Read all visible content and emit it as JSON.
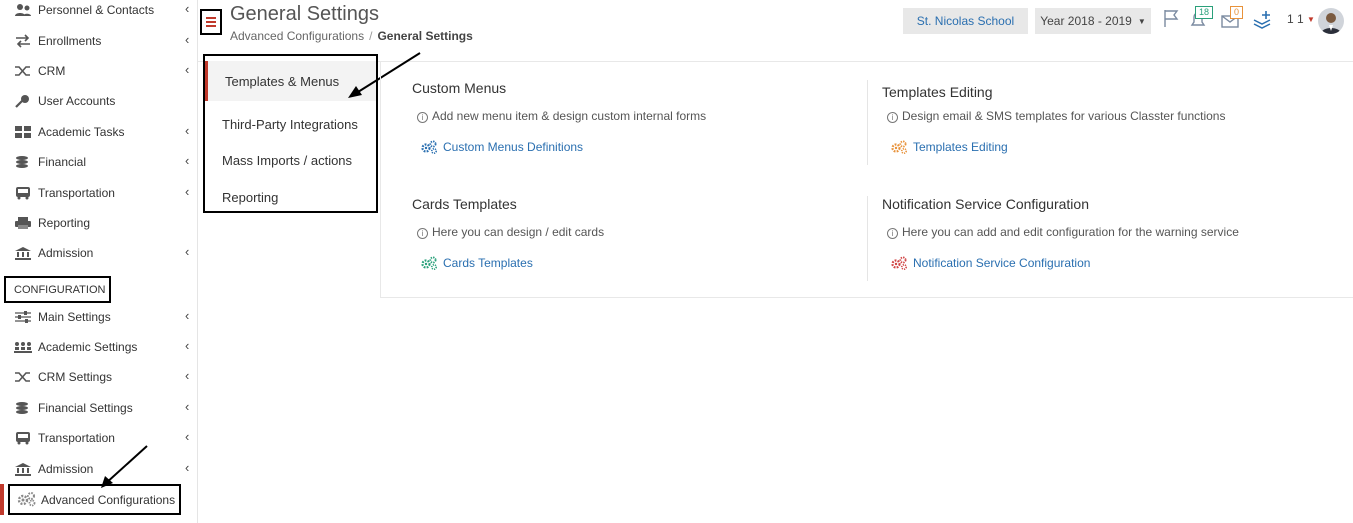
{
  "sidebar": {
    "items": [
      {
        "label": "Personnel & Contacts",
        "icon": "people-icon"
      },
      {
        "label": "Enrollments",
        "icon": "arrows-icon"
      },
      {
        "label": "CRM",
        "icon": "shuffle-icon"
      },
      {
        "label": "User Accounts",
        "icon": "key-icon"
      },
      {
        "label": "Academic Tasks",
        "icon": "grid-icon"
      },
      {
        "label": "Financial",
        "icon": "coins-icon"
      },
      {
        "label": "Transportation",
        "icon": "bus-icon"
      },
      {
        "label": "Reporting",
        "icon": "printer-icon"
      },
      {
        "label": "Admission",
        "icon": "institution-icon"
      }
    ],
    "section_label": "CONFIGURATION",
    "config_items": [
      {
        "label": "Main Settings",
        "icon": "sliders-icon"
      },
      {
        "label": "Academic Settings",
        "icon": "group-icon"
      },
      {
        "label": "CRM Settings",
        "icon": "shuffle-icon"
      },
      {
        "label": "Financial Settings",
        "icon": "coins-icon"
      },
      {
        "label": "Transportation",
        "icon": "bus-icon"
      },
      {
        "label": "Admission",
        "icon": "institution-icon"
      },
      {
        "label": "Advanced Configurations",
        "icon": "cogs-icon"
      }
    ]
  },
  "header": {
    "title": "General Settings",
    "breadcrumb": [
      "Advanced Configurations",
      "General Settings"
    ],
    "breadcrumb_sep": "/",
    "school": "St. Nicolas School",
    "year": "Year 2018 - 2019",
    "notifications_count": "18",
    "messages_count": "0",
    "user_number": "1 1"
  },
  "submenu": {
    "items": [
      "Templates & Menus",
      "Third-Party Integrations",
      "Mass Imports / actions",
      "Reporting"
    ]
  },
  "sections": [
    {
      "title": "Custom Menus",
      "desc": "Add new menu item & design custom internal forms",
      "link": "Custom Menus Definitions",
      "icon_color": "#2a6fb0"
    },
    {
      "title": "Templates Editing",
      "desc": "Design email & SMS templates for various Classter functions",
      "link": "Templates Editing",
      "icon_color": "#e8923a"
    },
    {
      "title": "Cards Templates",
      "desc": "Here you can design / edit cards",
      "link": "Cards Templates",
      "icon_color": "#2aa07a"
    },
    {
      "title": "Notification Service Configuration",
      "desc": "Here you can add and edit configuration for the warning service",
      "link": "Notification Service Configuration",
      "icon_color": "#d04545"
    }
  ],
  "colors": {
    "accent": "#c0392b",
    "link": "#2a6fb0"
  }
}
